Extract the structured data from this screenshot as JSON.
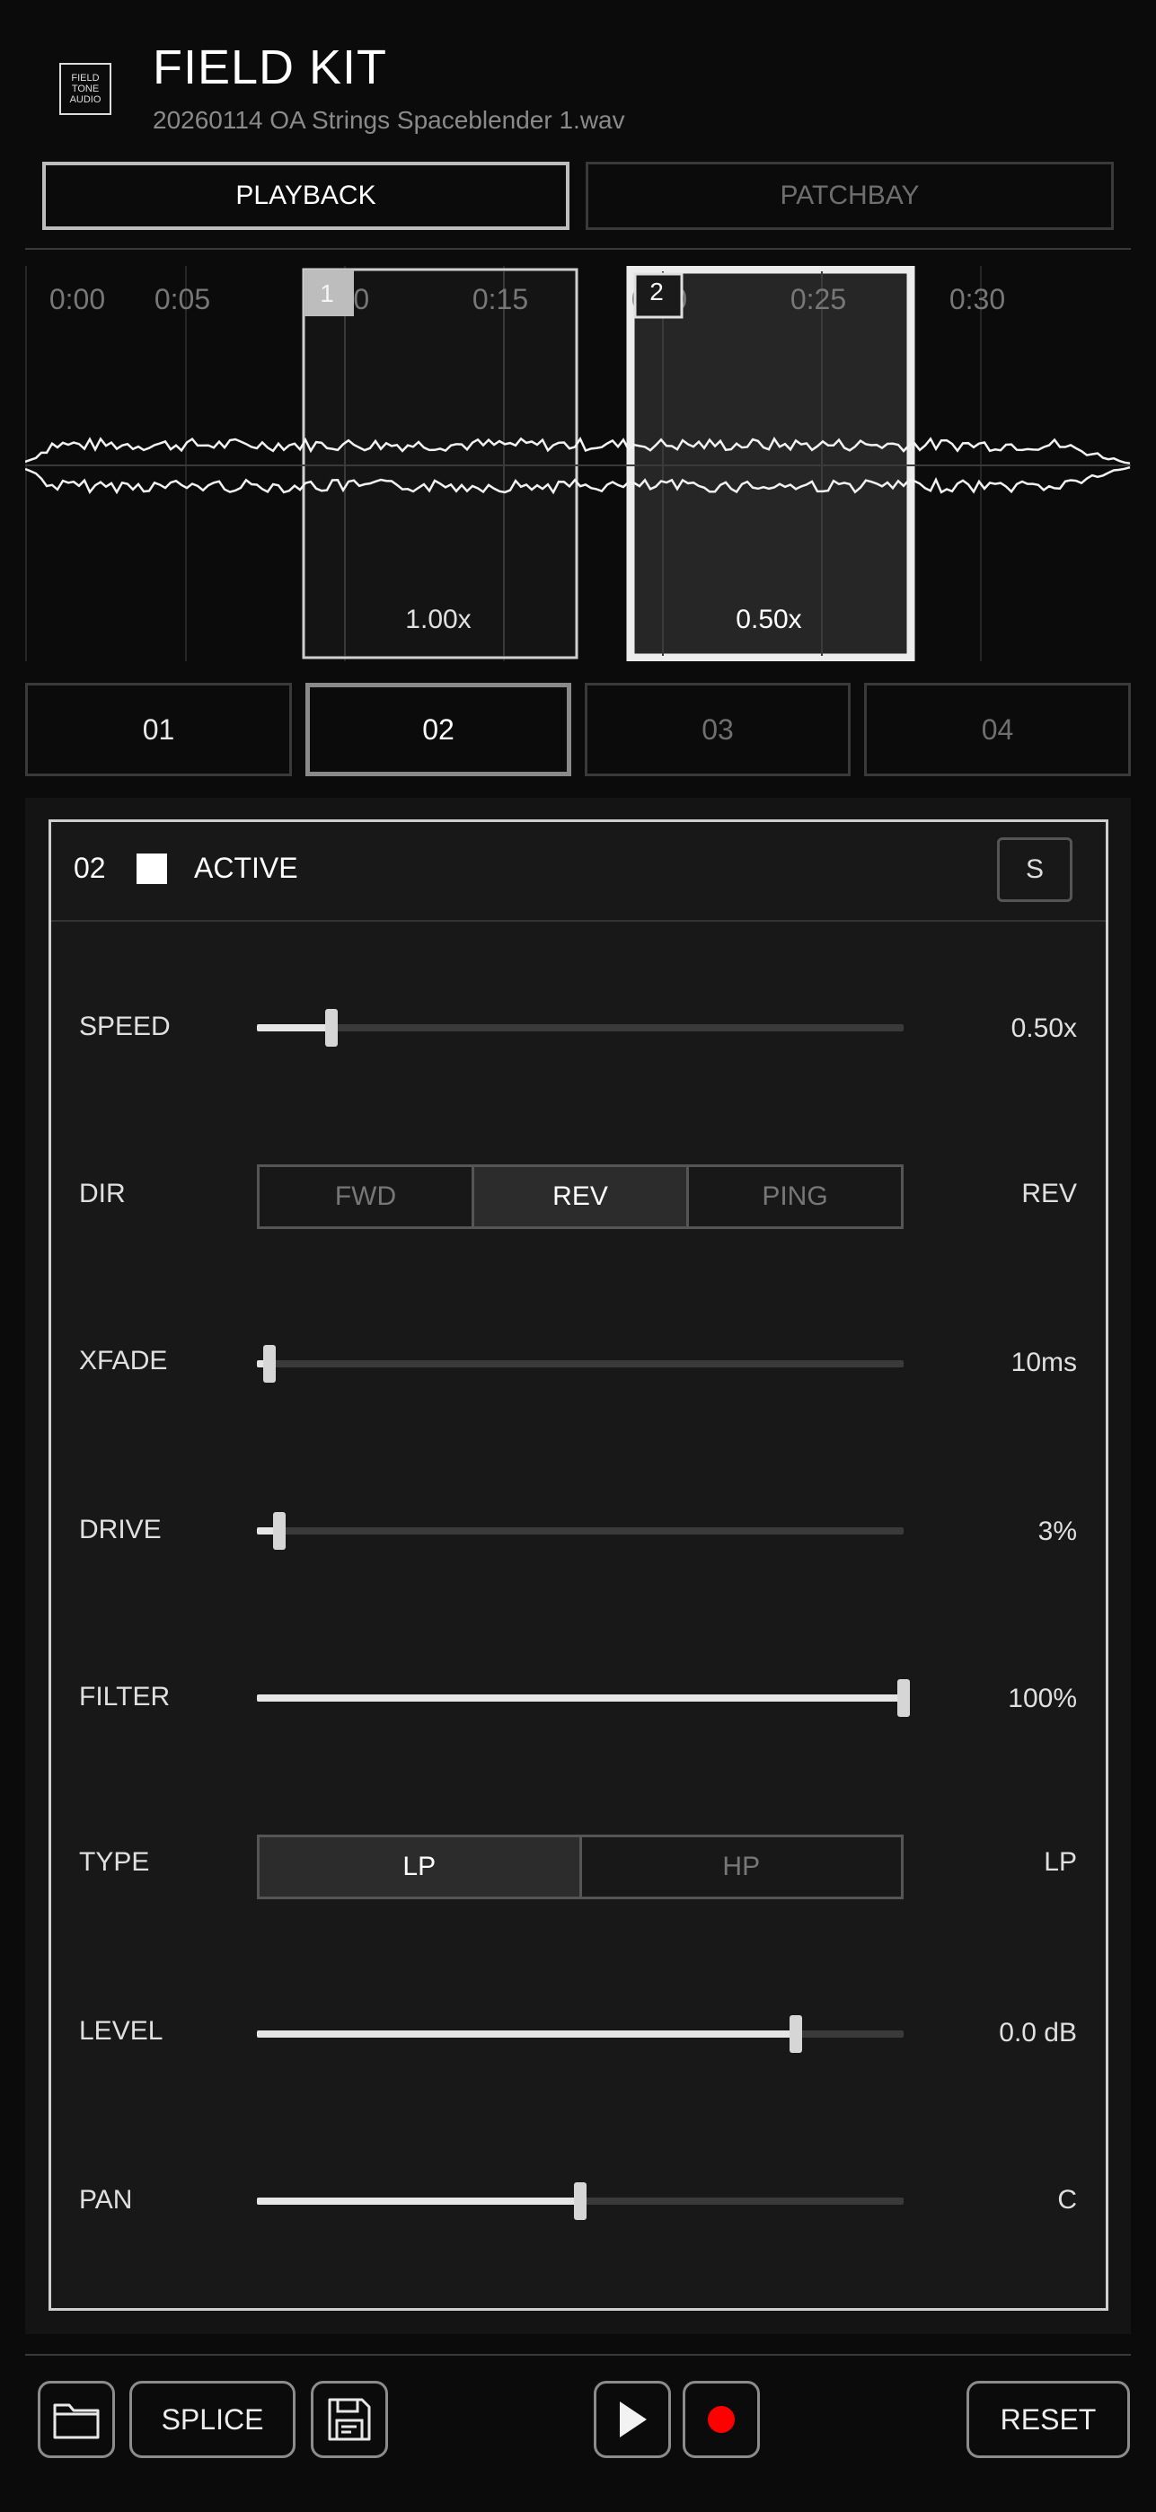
{
  "header": {
    "logo_lines": [
      "FIELD",
      "TONE",
      "AUDIO"
    ],
    "title": "FIELD KIT",
    "filename": "20260114 OA Strings Spaceblender 1.wav"
  },
  "tabs": [
    {
      "label": "PLAYBACK",
      "active": true
    },
    {
      "label": "PATCHBAY",
      "active": false
    }
  ],
  "timeline": {
    "ticks": [
      "0:00",
      "0:05",
      "0:10",
      "0:15",
      "0:20",
      "0:25",
      "0:30"
    ],
    "regions": [
      {
        "id": "1",
        "speed": "1.00x",
        "selected": false
      },
      {
        "id": "2",
        "speed": "0.50x",
        "selected": true
      }
    ]
  },
  "slots": [
    {
      "label": "01",
      "selected": false,
      "dim": false
    },
    {
      "label": "02",
      "selected": true,
      "dim": false
    },
    {
      "label": "03",
      "selected": false,
      "dim": true
    },
    {
      "label": "04",
      "selected": false,
      "dim": true
    }
  ],
  "panel": {
    "slot": "02",
    "active_label": "ACTIVE",
    "active": true,
    "solo_label": "S",
    "params": {
      "speed": {
        "label": "SPEED",
        "value": "0.50x",
        "level": 0.115
      },
      "dir": {
        "label": "DIR",
        "value": "REV",
        "options": [
          "FWD",
          "REV",
          "PING"
        ],
        "selected": 1
      },
      "xfade": {
        "label": "XFADE",
        "value": "10ms",
        "level": 0.02
      },
      "drive": {
        "label": "DRIVE",
        "value": "3%",
        "level": 0.035
      },
      "filter": {
        "label": "FILTER",
        "value": "100%",
        "level": 1.0
      },
      "type": {
        "label": "TYPE",
        "value": "LP",
        "options": [
          "LP",
          "HP"
        ],
        "selected": 0
      },
      "level": {
        "label": "LEVEL",
        "value": "0.0 dB",
        "level": 0.833
      },
      "pan": {
        "label": "PAN",
        "value": "C",
        "level": 0.5
      }
    }
  },
  "bottom": {
    "folder_icon": "folder-icon",
    "splice_label": "SPLICE",
    "save_icon": "save-icon",
    "play_icon": "play-icon",
    "record_icon": "record-icon",
    "record_color": "#ff0000",
    "reset_label": "RESET"
  }
}
